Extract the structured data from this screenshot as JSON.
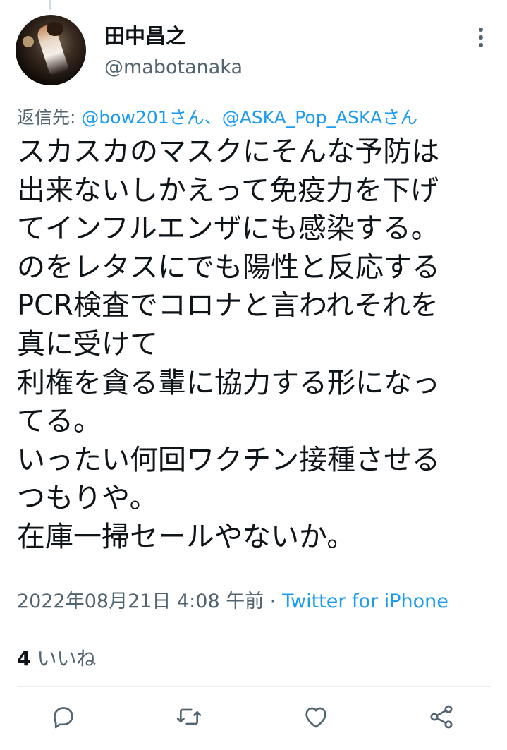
{
  "user": {
    "display_name": "田中昌之",
    "handle": "@mabotanaka"
  },
  "reply_to": {
    "prefix": "返信先: ",
    "mentions": "@bow201さん、@ASKA_Pop_ASKAさん"
  },
  "tweet": {
    "text": "スカスカのマスクにそんな予防は\n出来ないしかえって免疫力を下げ\nてインフルエンザにも感染する。\nのをレタスにでも陽性と反応する\nPCR検査でコロナと言われそれを\n真に受けて\n利権を貪る輩に協力する形になっ\nてる。\nいったい何回ワクチン接種させる\nつもりや。\n在庫一掃セールやないか。"
  },
  "meta": {
    "timestamp": "2022年08月21日 4:08 午前 · ",
    "source": "Twitter for iPhone"
  },
  "likes": {
    "count": "4",
    "label": " いいね"
  },
  "icons": {
    "more": "more-vertical-icon",
    "reply": "reply-icon",
    "retweet": "retweet-icon",
    "like": "like-icon",
    "share": "share-icon"
  },
  "colors": {
    "text": "#0f1419",
    "secondary": "#536471",
    "accent": "#1d9bf0",
    "divider": "#e6ecf0"
  }
}
